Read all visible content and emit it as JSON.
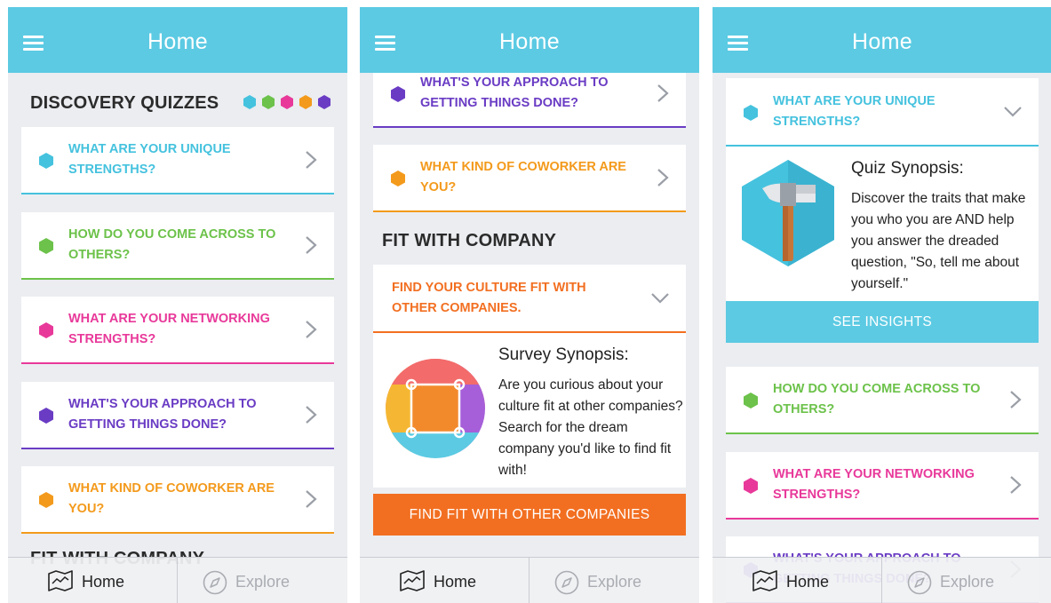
{
  "header": {
    "title": "Home"
  },
  "nav": {
    "home_label": "Home",
    "explore_label": "Explore"
  },
  "colors": {
    "header": "#5ccae3",
    "cyan": "#45c2de",
    "green": "#6cc24a",
    "pink": "#e8399a",
    "purple": "#6a3cc4",
    "orange": "#f39a1c",
    "orange_dark": "#f26f21"
  },
  "screen1": {
    "section_title": "DISCOVERY QUIZZES",
    "section2_title": "FIT WITH COMPANY",
    "quizzes": [
      {
        "label": "What are your unique strengths?",
        "color": "cyan"
      },
      {
        "label": "How do you come across to others?",
        "color": "green"
      },
      {
        "label": "What are your networking strengths?",
        "color": "pink"
      },
      {
        "label": "What's your approach to getting things done?",
        "color": "purple"
      },
      {
        "label": "What kind of coworker are you?",
        "color": "orange"
      }
    ]
  },
  "screen2": {
    "quizzes": [
      {
        "label": "What's your approach to getting things done?",
        "color": "purple"
      },
      {
        "label": "What kind of coworker are you?",
        "color": "orange"
      }
    ],
    "section_title": "FIT WITH COMPANY",
    "fit_card_label": "Find your culture fit with other companies.",
    "synopsis_title": "Survey Synopsis:",
    "synopsis_body": "Are you curious about your culture fit at other companies? Search for the dream company you'd like to find fit with!",
    "cta_label": "FIND FIT WITH OTHER COMPANIES"
  },
  "screen3": {
    "expanded_label": "What are your unique strengths?",
    "synopsis_title": "Quiz Synopsis:",
    "synopsis_body": "Discover the traits that make you who you are AND help you answer the dreaded question, \"So, tell me about yourself.\"",
    "cta_label": "SEE INSIGHTS",
    "quizzes": [
      {
        "label": "How do you come across to others?",
        "color": "green"
      },
      {
        "label": "What are your networking strengths?",
        "color": "pink"
      },
      {
        "label": "What's your approach to getting things done?",
        "color": "purple"
      }
    ]
  }
}
